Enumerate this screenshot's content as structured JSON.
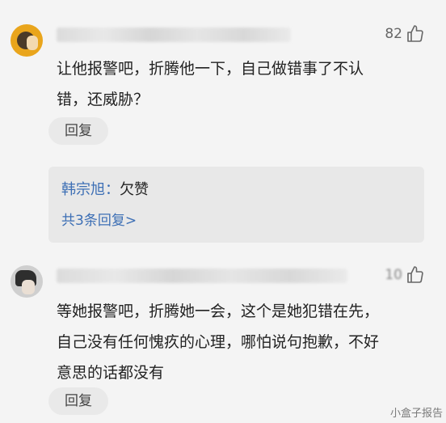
{
  "comments": [
    {
      "likes": "82",
      "text_lines": [
        "让他报警吧，折腾他一下，自己做错事了不认",
        "错，还威胁？"
      ],
      "reply_label": "回复",
      "replies": {
        "first_author": "韩宗旭：",
        "first_text": "欠赞",
        "more_link": "共3条回复>"
      }
    },
    {
      "likes": "10",
      "text_lines": [
        "等她报警吧，折腾她一会，这个是她犯错在先，",
        "自己没有任何愧疚的心理，哪怕说句抱歉，不好",
        "意思的话都没有"
      ],
      "reply_label": "回复"
    }
  ],
  "watermark": "小盒子报告",
  "icons": {
    "like": "thumbs-up-icon",
    "avatar": "avatar"
  },
  "colors": {
    "link": "#3d6fb5",
    "background": "#f4f4f4",
    "reply_box": "#e8e8e8"
  }
}
